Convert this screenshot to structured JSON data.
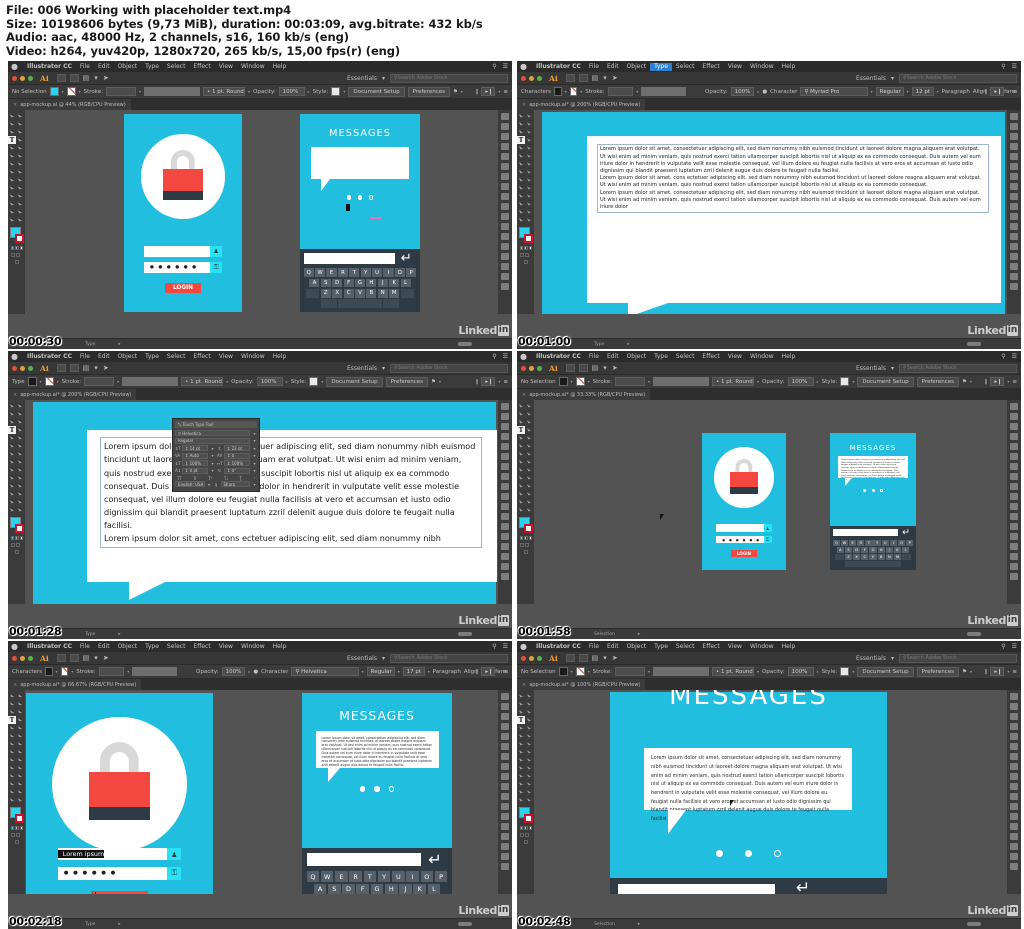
{
  "file_info": {
    "line1": "File: 006 Working with placeholder text.mp4",
    "line2": "Size: 10198606 bytes (9,73 MiB), duration: 00:03:09, avg.bitrate: 432 kb/s",
    "line3": "Audio: aac, 48000 Hz, 2 channels, s16, 160 kb/s (eng)",
    "line4": "Video: h264, yuv420p, 1280x720, 265 kb/s, 15,00 fps(r) (eng)"
  },
  "menu": {
    "apple": "●",
    "items": [
      "Illustrator CC",
      "File",
      "Edit",
      "Object",
      "Type",
      "Select",
      "Effect",
      "View",
      "Window",
      "Help"
    ],
    "search_icon": "⚲",
    "list_icon": "☰"
  },
  "app": {
    "logo": "Ai",
    "essentials": "Essentials",
    "essentials_caret": "▾",
    "search_placeholder": "Search Adobe Stock",
    "search_icon": "⚲"
  },
  "control_bar": {
    "no_selection": "No Selection",
    "characters": "Characters",
    "stroke": "Stroke:",
    "stroke_profile": "1 pt. Round",
    "opacity_label": "Opacity:",
    "opacity_value": "100%",
    "style_label": "Style:",
    "character_label": "Character",
    "paragraph_label": "Paragraph",
    "align_label": "Align",
    "transform_label": "Transform",
    "document_setup": "Document Setup",
    "preferences": "Preferences",
    "font_myriad": "Myriad Pro",
    "font_helvetica": "Helvetica",
    "weight_regular": "Regular",
    "size_12": "12 pt",
    "size_17": "17 pt"
  },
  "status_bar": {
    "selection": "Selection",
    "type": "Type",
    "nav_first": "⏮",
    "nav_prev": "◀",
    "nav_next": "▶",
    "nav_last": "⏭"
  },
  "mockup": {
    "messages_title": "MESSAGES",
    "login_label": "LOGIN",
    "password_dots": "● ● ● ● ● ●",
    "username_placeholder": "Lorem ipsum",
    "user_icon": "♟",
    "lock_icon": "⚿",
    "enter_key": "↵",
    "keyboard_row1": [
      "Q",
      "W",
      "E",
      "R",
      "T",
      "Y",
      "U",
      "I",
      "O",
      "P"
    ],
    "keyboard_row2": [
      "A",
      "S",
      "D",
      "F",
      "G",
      "H",
      "J",
      "K",
      "L"
    ],
    "keyboard_row3": [
      "Z",
      "X",
      "C",
      "V",
      "B",
      "N",
      "M"
    ],
    "bubble_text": "Lorem ipsum dolor sit amet, consectetuer adipiscing elit, sed diam nonummy nibh euismod tincidunt ut laoreet dolore magna aliquam erat volutpat. Ut wisi enim ad minim veniam, quis nostrud exerci tation ullamcorper suscipit lobortis nisl ut aliquip ex ea commodo consequat. Duis autem vel eum iriure dolor in hendrerit in vulputate velit esse molestie consequat, vel illum dolore eu feugiat nulla facilisis at vero eros et accumsan et iusto odio dignissim qui blandit praesent luptatum zzril delenit augue duis dolore te feugait nulla facilisi."
  },
  "lorem": {
    "para1": "Lorem ipsum dolor sit amet, consectetuer adipiscing elit, sed diam nonummy nibh euismod tincidunt ut laoreet dolore magna aliquam erat volutpat. Ut wisi enim ad minim veniam, quis nostrud exerci tation ullamcorper suscipit lobortis nisl ut aliquip ex ea commodo consequat. Duis autem vel eum iriure dolor in hendrerit in vulputate velit esse molestie consequat, vel illum dolore eu feugiat nulla facilisis at vero eros et accumsan et iusto odio dignissim qui blandit praesent luptatum zzril delenit augue duis dolore te feugait nulla facilisi.",
    "para2": "Lorem ipsum dolor sit amet, cons ectetuer adipiscing elit, sed diam nonummy nibh euismod tincidunt ut laoreet dolore reagna aliquam erat volutpat. Ut wisi enim ad minim veniam, quis nostrud exerci tation ullamcorper suscipit lobortis nisl ut aliquip ex ea commodo consequat.",
    "para3": "Lorem ipsum dolor sit amet, consectetuer adipiscing elit, sed diam nonummy nibh euismod tincidunt ut laoreet dolore magna aliquam erat volutpat. Ut wisi enim ad minim veniam, quis nostrud exerci tation ullamcorper suscipit lobortis nisl ut aliquip ex ea commodo consequat. Duis autem vel eum iriure dolor",
    "large_text": "Lorem ipsum dolor sit amet, consectetuer adipiscing elit, sed diam nonummy nibh euismod tincidunt ut laoreet dolore magna aliquam erat volutpat. Ut wisi enim ad minim veniam, quis nostrud exerci tation ullamcorper suscipit lobortis nisl ut aliquip ex ea commodo consequat. Duis autem vel eum iriure dolor in hendrerit in vulputate velit esse molestie consequat, vel illum dolore eu feugiat nulla facilisis at vero et accumsan et iusto odio dignissim qui blandit praesent luptatum zzril delenit augue duis dolore te feugait nulla facilisi.",
    "large_text2": "Lorem ipsum dolor sit amet, cons ectetuer adipiscing elit, sed diam nonummy nibh"
  },
  "char_panel": {
    "touch_type_tool": "Touch Type Tool",
    "font": "Helvetica",
    "style": "Regular",
    "size": "14 pt",
    "leading": "22 pt",
    "kerning": "Auto",
    "tracking": "0",
    "vscale": "100%",
    "hscale": "100%",
    "baseline": "0 pt",
    "rotation": "0°",
    "language": "English: USA",
    "anti_alias": "Sharp",
    "glyph_row": [
      "TT",
      "Tr",
      "T¹",
      "T₁",
      "T̲",
      "ᵀ"
    ]
  },
  "panels": [
    {
      "id": 1,
      "timestamp": "00:00:30",
      "tab": "app-mockup.ai @ 44% (RGB/CPU Preview)",
      "zoom": "44%",
      "menu_selected": "",
      "mode": "No Selection",
      "status_mode": "Type"
    },
    {
      "id": 2,
      "timestamp": "00:01:00",
      "tab": "app-mockup.ai* @ 200% (RGB/CPU Preview)",
      "zoom": "200%",
      "menu_selected": "Type",
      "mode": "Characters",
      "status_mode": "Type"
    },
    {
      "id": 3,
      "timestamp": "00:01:28",
      "tab": "app-mockup.ai* @ 200% (RGB/CPU Preview)",
      "zoom": "200%",
      "menu_selected": "",
      "mode": "Type",
      "status_mode": "Type"
    },
    {
      "id": 4,
      "timestamp": "00:01:58",
      "tab": "app-mockup.ai* @ 33.33% (RGB/CPU Preview)",
      "zoom": "33.33%",
      "menu_selected": "",
      "mode": "No Selection",
      "status_mode": "Selection"
    },
    {
      "id": 5,
      "timestamp": "00:02:18",
      "tab": "app-mockup.ai* @ 66.67% (RGB/CPU Preview)",
      "zoom": "66.67%",
      "menu_selected": "",
      "mode": "Characters",
      "status_mode": "Type"
    },
    {
      "id": 6,
      "timestamp": "00:02:48",
      "tab": "app-mockup.ai* @ 100% (RGB/CPU Preview)",
      "zoom": "100%",
      "menu_selected": "",
      "mode": "No Selection",
      "status_mode": "Selection"
    }
  ],
  "linkedin": {
    "text": "Linked",
    "badge": "in"
  },
  "colors": {
    "cyan": "#22bee0",
    "red": "#f4473f",
    "dark_navy": "#2e3b45",
    "key_gray": "#556069",
    "accent_cyan": "#28e3f5",
    "canvas_gray": "#535353",
    "panel_gray": "#3b3b3b",
    "menu_selected": "#2f7fd1"
  }
}
